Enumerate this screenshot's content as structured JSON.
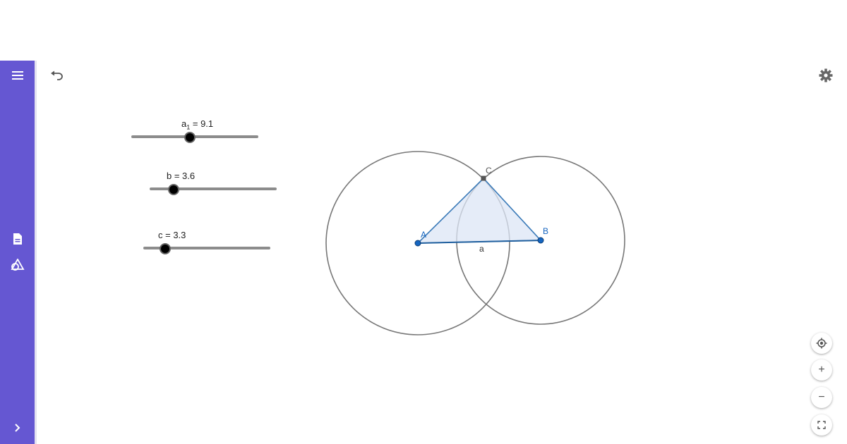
{
  "sidebar": {
    "menu_icon": "menu-icon",
    "items": [
      {
        "name": "algebra-view-icon"
      },
      {
        "name": "geometry-tools-icon"
      }
    ],
    "expand_icon": "chevron-right-icon"
  },
  "toolbar": {
    "undo_icon": "undo-icon",
    "settings_icon": "gear-icon"
  },
  "sliders": [
    {
      "label_main": "a",
      "label_sub": "1",
      "label_rest": " = 9.1",
      "value": 9.1,
      "fraction": 0.46
    },
    {
      "label": "b = 3.6",
      "value": 3.6,
      "fraction": 0.19
    },
    {
      "label": "c = 3.3",
      "value": 3.3,
      "fraction": 0.17
    }
  ],
  "construction": {
    "points": [
      {
        "name": "A",
        "color": "#1565c0"
      },
      {
        "name": "B",
        "color": "#1565c0"
      },
      {
        "name": "C",
        "color": "#555555"
      }
    ],
    "segment_label": "a",
    "triangle_stroke": "#3a7ab8",
    "triangle_fill": "#dce6f5",
    "circle_stroke": "#777777"
  },
  "zoom_controls": {
    "recenter_icon": "recenter-icon",
    "zoom_in_symbol": "+",
    "zoom_out_symbol": "−",
    "fullscreen_icon": "fullscreen-icon"
  },
  "colors": {
    "sidebar": "#6557d2",
    "icon_gray": "#555555"
  }
}
